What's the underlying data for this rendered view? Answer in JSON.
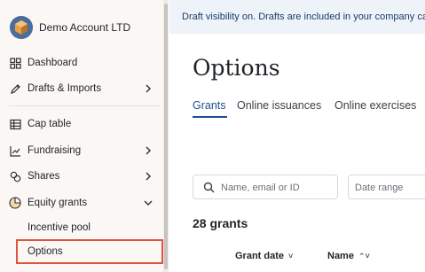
{
  "sidebar": {
    "account_name": "Demo Account LTD",
    "items": [
      {
        "label": "Dashboard",
        "icon": "grid-icon"
      },
      {
        "label": "Drafts & Imports",
        "icon": "pencil-icon"
      },
      {
        "label": "Cap table",
        "icon": "table-icon"
      },
      {
        "label": "Fundraising",
        "icon": "chart-icon"
      },
      {
        "label": "Shares",
        "icon": "shares-icon"
      },
      {
        "label": "Equity grants",
        "icon": "pie-icon"
      }
    ],
    "sub_items": [
      {
        "label": "Incentive pool"
      },
      {
        "label": "Options",
        "selected": true
      }
    ]
  },
  "banner": {
    "text": "Draft visibility on. Drafts are included in your company ca"
  },
  "main": {
    "title": "Options",
    "tabs": [
      {
        "label": "Grants",
        "active": true
      },
      {
        "label": "Online issuances"
      },
      {
        "label": "Online exercises"
      }
    ],
    "search_placeholder": "Name, email or ID",
    "date_placeholder": "Date range",
    "grants_count": "28 grants",
    "columns": [
      {
        "label": "Grant date",
        "sort": "˅"
      },
      {
        "label": "Name",
        "sort": "⌃˅"
      }
    ]
  },
  "colors": {
    "accent": "#1d4f91",
    "highlight_border": "#e0533c",
    "sidebar_bg": "#fbf7f5",
    "banner_bg": "#eef3fa"
  }
}
